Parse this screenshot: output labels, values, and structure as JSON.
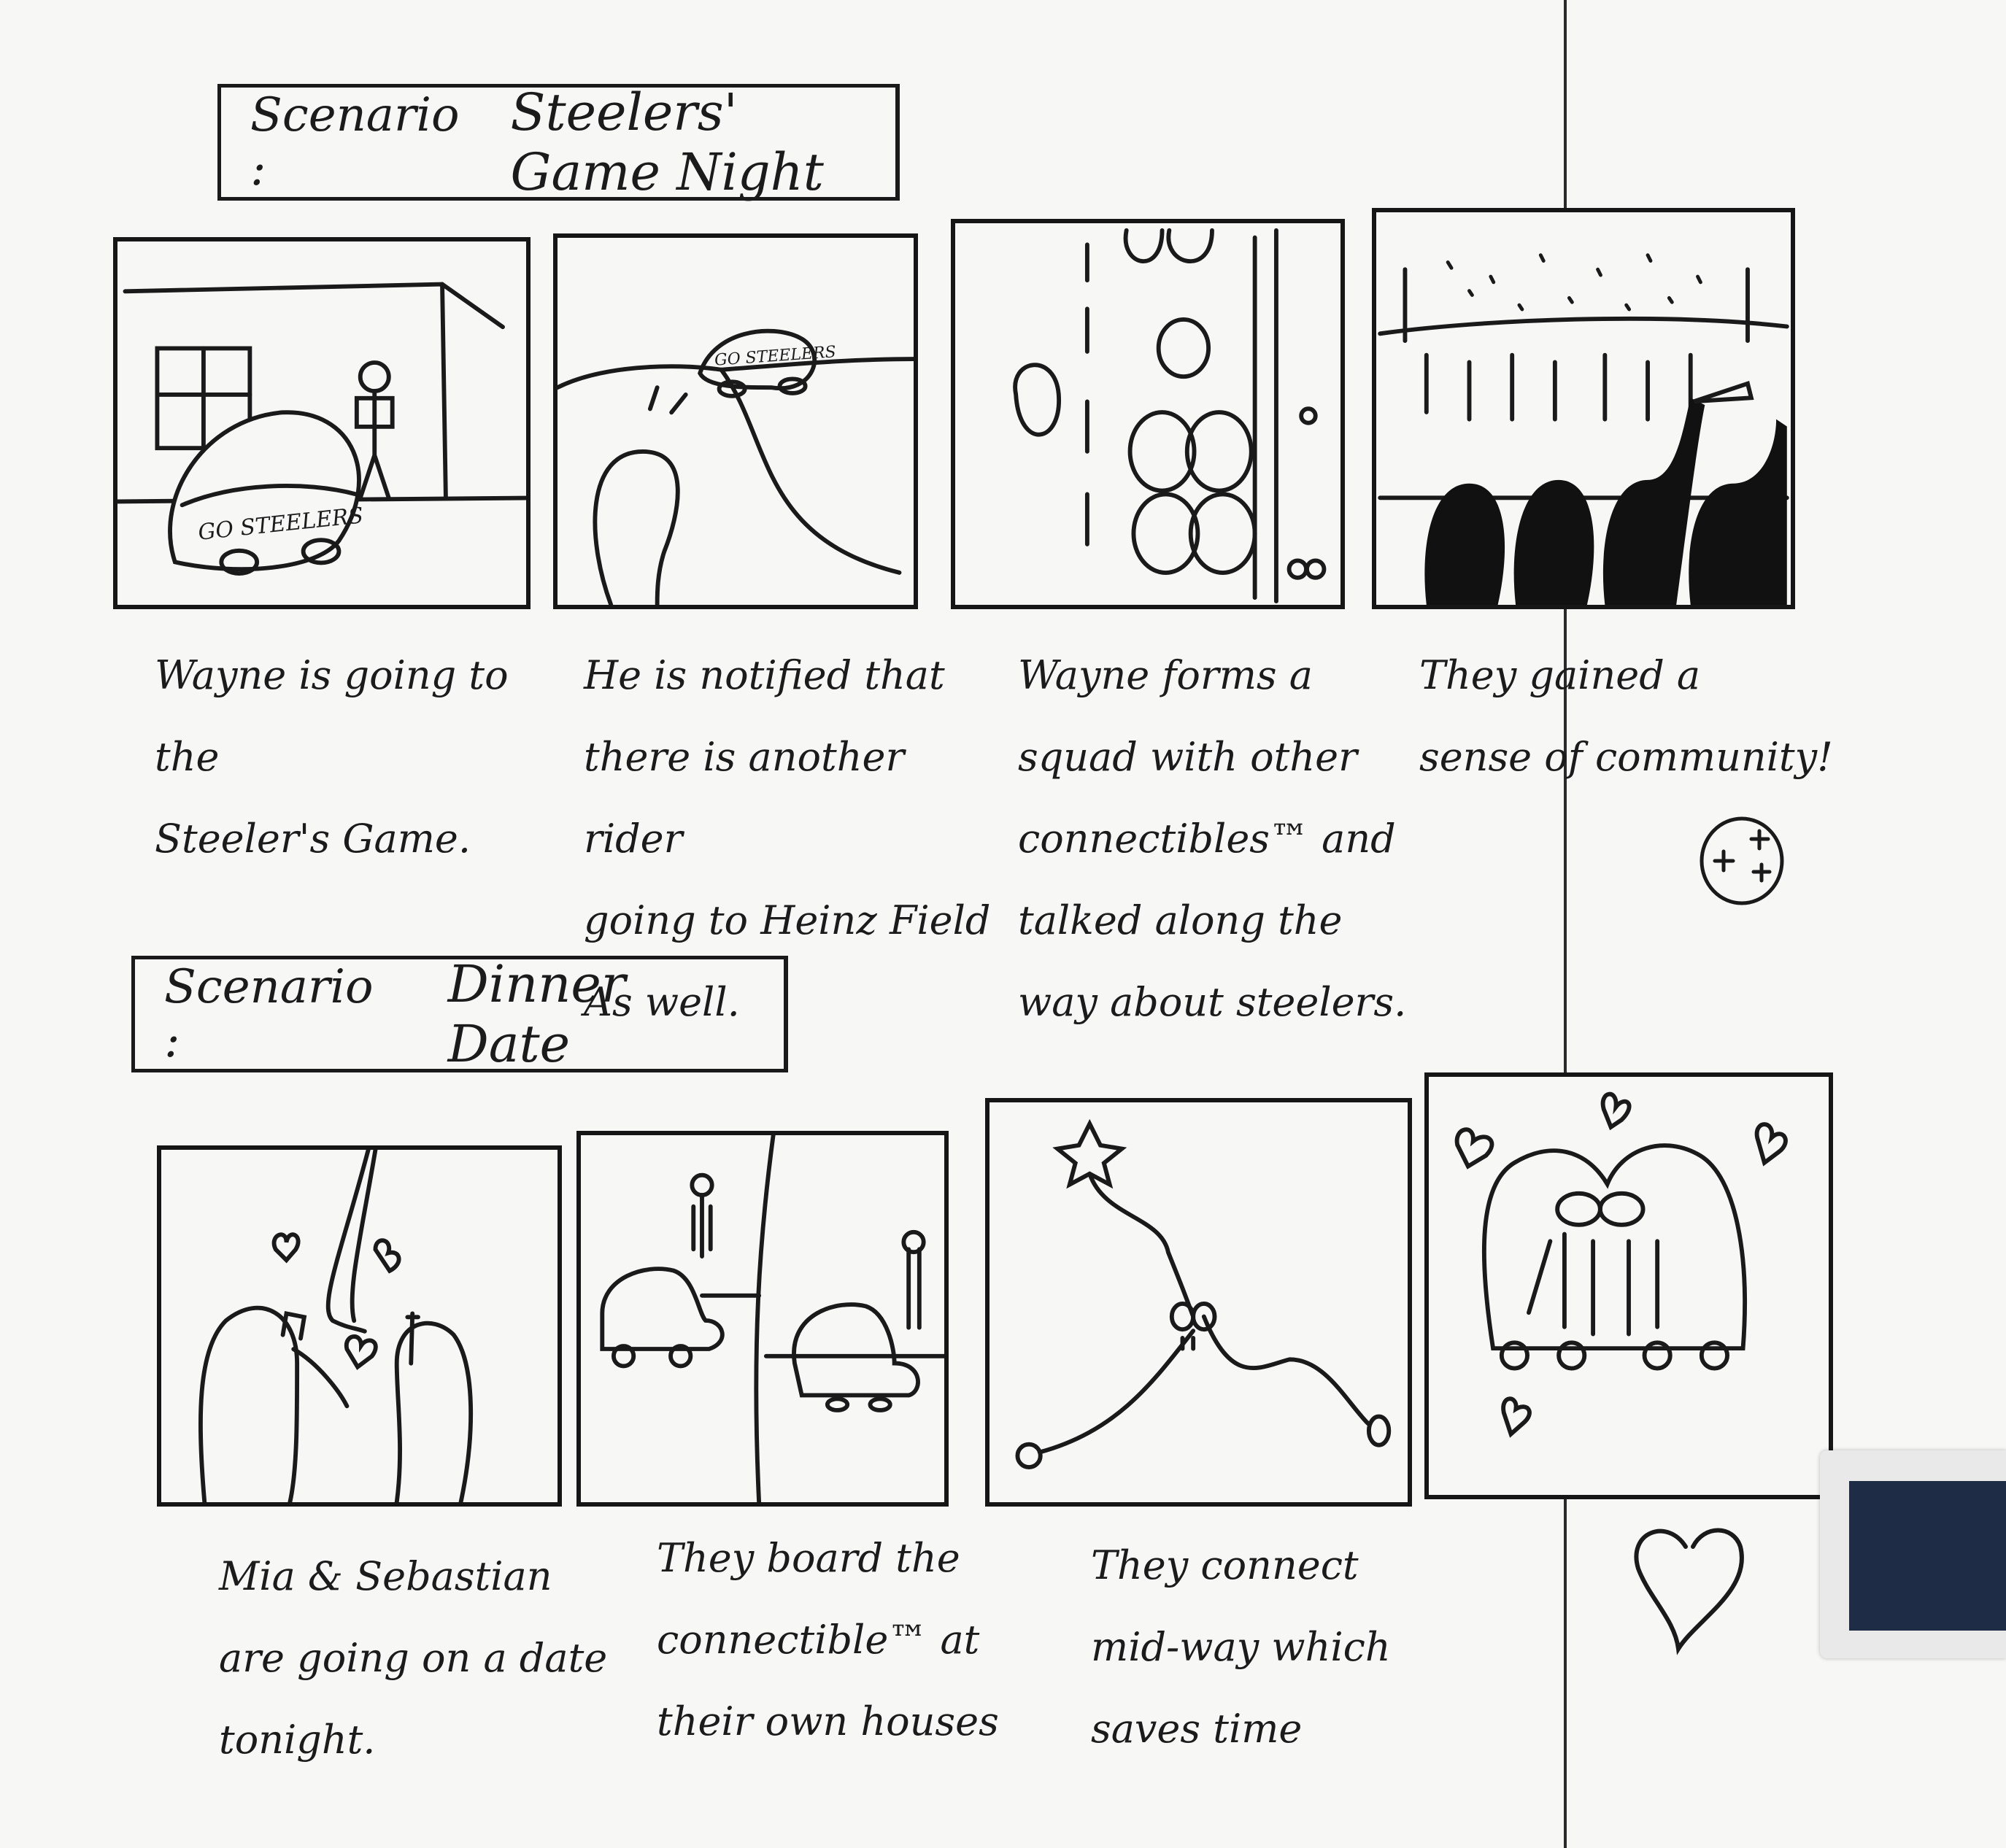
{
  "scenarios": [
    {
      "label": "Scenario :",
      "title": "Steelers' Game Night",
      "car_text": {
        "go": "GO",
        "team": "STEELERS"
      },
      "captions": [
        "Wayne is going to the\nSteeler's Game.",
        "He is notified that\nthere is another rider\ngoing to Heinz Field\nAs well.",
        "Wayne forms a\nsquad with other\nconnectibles™ and\ntalked along the\nway about steelers.",
        "They gained a\nsense of community!"
      ]
    },
    {
      "label": "Scenario :",
      "title": "Dinner Date",
      "captions": [
        "Mia & Sebastian\nare going on a date\ntonight.",
        "They board the\nconnectible™ at\ntheir own houses",
        "They connect\nmid-way which\nsaves time"
      ]
    }
  ]
}
